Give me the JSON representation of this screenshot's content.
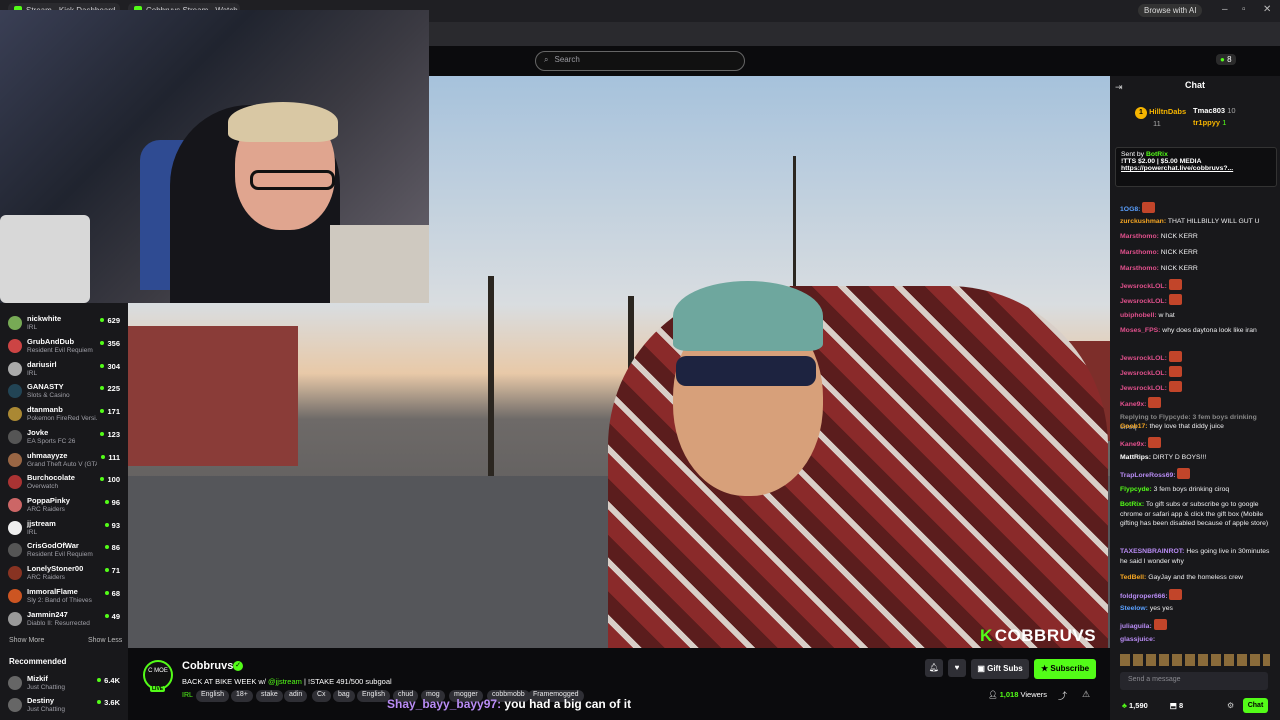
{
  "browser": {
    "tabs": [
      {
        "label": "Stream · Kick Dashboard"
      },
      {
        "label": "Cobbruvs Stream · Watch"
      }
    ],
    "browse_ai": "Browse with AI"
  },
  "header": {
    "search_placeholder": "Search",
    "notif_count": "8"
  },
  "sidebar": {
    "items": [
      {
        "name": "",
        "game": "IRL",
        "viewers": ""
      },
      {
        "name": "nickwhite",
        "game": "IRL",
        "viewers": "629"
      },
      {
        "name": "GrubAndDub",
        "game": "Resident Evil Requiem",
        "viewers": "356"
      },
      {
        "name": "dariusirl",
        "game": "IRL",
        "viewers": "304"
      },
      {
        "name": "GANASTY",
        "game": "Slots & Casino",
        "viewers": "225"
      },
      {
        "name": "dtanmanb",
        "game": "Pokemon FireRed Versi...",
        "viewers": "171"
      },
      {
        "name": "Jovke",
        "game": "EA Sports FC 26",
        "viewers": "123"
      },
      {
        "name": "uhmaayyze",
        "game": "Grand Theft Auto V (GTA)",
        "viewers": "111"
      },
      {
        "name": "Burchocolate",
        "game": "Overwatch",
        "viewers": "100"
      },
      {
        "name": "PoppaPinky",
        "game": "ARC Raiders",
        "viewers": "96"
      },
      {
        "name": "jjstream",
        "game": "IRL",
        "viewers": "93"
      },
      {
        "name": "CrisGodOfWar",
        "game": "Resident Evil Requiem",
        "viewers": "86"
      },
      {
        "name": "LonelyStoner00",
        "game": "ARC Raiders",
        "viewers": "71"
      },
      {
        "name": "ImmoralFlame",
        "game": "Sly 2: Band of Thieves",
        "viewers": "68"
      },
      {
        "name": "Jammin247",
        "game": "Diablo II: Resurrected",
        "viewers": "49"
      }
    ],
    "show_more": "Show More",
    "show_less": "Show Less",
    "recommended_title": "Recommended",
    "recommended": [
      {
        "name": "Mizkif",
        "game": "Just Chatting",
        "viewers": "6.4K"
      },
      {
        "name": "Destiny",
        "game": "Just Chatting",
        "viewers": "3.6K"
      }
    ]
  },
  "video": {
    "watermark": "COBBRUVS"
  },
  "channel": {
    "avatar_text": "C MOE",
    "live": "LIVE",
    "name": "Cobbruvs",
    "title_pre": "BACK AT BIKE WEEK w/ ",
    "title_mention": "@jjstream",
    "title_post": " | !STAKE 491/500 subgoal",
    "category": "IRL",
    "tags": [
      "English",
      "18+",
      "stake",
      "adin",
      "Cx",
      "bag",
      "English",
      "chud",
      "mog",
      "mogger",
      "cobbmobb",
      "Framemogged"
    ],
    "gift_subs": "Gift Subs",
    "subscribe": "Subscribe",
    "viewers": "1,018",
    "viewers_label": "Viewers"
  },
  "ticker": {
    "user": "Shay_bayy_bayy97:",
    "text": " you had a big can of it"
  },
  "chat": {
    "title": "Chat",
    "leaders": [
      {
        "rank": "1",
        "name": "HilltnDabs",
        "count": "11"
      },
      {
        "name": "Tmac803",
        "count": "10"
      },
      {
        "name": "tr1ppyy",
        "count": "1"
      }
    ],
    "pinned": {
      "sent_by": "Sent by",
      "bot": "BotRix",
      "line2": "!TTS $2.00 | $5.00 MEDIA",
      "line3": "https://powerchat.live/cobbruvs?..."
    },
    "messages": [
      {
        "user": "1OG8:",
        "text": "",
        "color": "#5aa0ff",
        "emote": true
      },
      {
        "user": "zurckushman:",
        "text": " THAT HILLBILLY WILL GUT U",
        "color": "#f5a623"
      },
      {
        "user": "Marsthomo:",
        "text": " NICK KERR",
        "color": "#e0508c"
      },
      {
        "user": "Marsthomo:",
        "text": " NICK KERR",
        "color": "#e0508c"
      },
      {
        "user": "Marsthomo:",
        "text": " NICK KERR",
        "color": "#e0508c"
      },
      {
        "user": "JewsrockLOL:",
        "text": "",
        "color": "#e0508c",
        "emote": true
      },
      {
        "user": "JewsrockLOL:",
        "text": "",
        "color": "#e0508c",
        "emote": true
      },
      {
        "user": "ubiphobell:",
        "text": " w hat",
        "color": "#e0508c"
      },
      {
        "user": "Moses_FPS:",
        "text": " why does daytona look like iran",
        "color": "#e0508c"
      },
      {
        "user": "JewsrockLOL:",
        "text": "",
        "color": "#e0508c",
        "emote": true
      },
      {
        "user": "JewsrockLOL:",
        "text": "",
        "color": "#e0508c",
        "emote": true
      },
      {
        "user": "JewsrockLOL:",
        "text": "",
        "color": "#e0508c",
        "emote": true
      },
      {
        "user": "Kane9x:",
        "text": "",
        "color": "#e0508c",
        "emote": true
      },
      {
        "user": "Replying to Flypcyde: 3 fem boys drinking ciroq",
        "text": "",
        "color": "#888888"
      },
      {
        "user": "Goob17:",
        "text": " they love that diddy juice",
        "color": "#f5a623"
      },
      {
        "user": "Kane9x:",
        "text": "",
        "color": "#e0508c",
        "emote": true
      },
      {
        "user": "MattRips:",
        "text": " DIRTY D BOYS!!!",
        "color": "#ffffff"
      },
      {
        "user": "TrapLoreRoss69:",
        "text": "",
        "color": "#b98cf5",
        "emote": true
      },
      {
        "user": "Flypcyde:",
        "text": " 3 fem boys drinking ciroq",
        "color": "#53fc18"
      },
      {
        "user": "BotRix:",
        "text": " To gift subs or subscribe go to google chrome or safari app & click the gift box (Mobile gifting has been disabled because of apple store)",
        "color": "#53fc18"
      },
      {
        "user": "TAXESNBRAINROT:",
        "text": " Hes going live in 30minutes he said  I wonder why",
        "color": "#b98cf5"
      },
      {
        "user": "TedBell:",
        "text": " GayJay and the homeless crew",
        "color": "#f5a623"
      },
      {
        "user": "foldgroper666:",
        "text": "",
        "color": "#b98cf5",
        "emote": true
      },
      {
        "user": "Steelow:",
        "text": " yes yes",
        "color": "#5aa0ff"
      },
      {
        "user": "juliaguila:",
        "text": "",
        "color": "#b98cf5",
        "emote": true
      },
      {
        "user": "glassjuice:",
        "text": "",
        "color": "#b98cf5"
      }
    ],
    "input_placeholder": "Send a message",
    "points": "1,590",
    "badge_count": "8",
    "chat_button": "Chat"
  },
  "colors": {
    "accent": "#53fc18",
    "bg": "#0e0e10",
    "panel": "#18181b"
  }
}
